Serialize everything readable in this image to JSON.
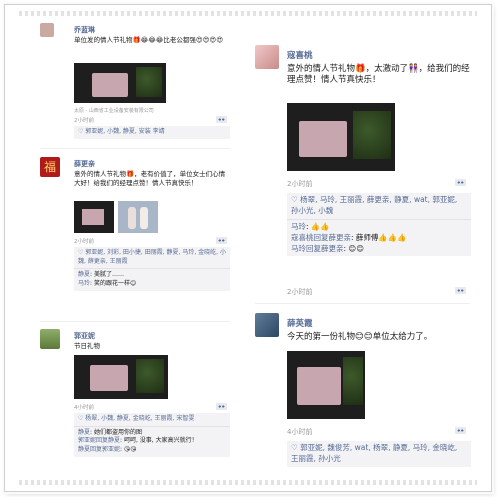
{
  "left_column": {
    "posts": [
      {
        "name": "乔蓝琳",
        "text": "单位发的情人节礼物🎁😂😂😂比老公都强😍😍😍😍",
        "location": "太原 · 山西省工业设备安装有限公司",
        "time": "2小时前",
        "likes": "♡ 郭亚妮, 小魏, 静夏, 安装 李靖"
      },
      {
        "name": "薛更亲",
        "text": "意外的情人节礼物🎁，老有价值了，单位女士们心情大好！给我们的经理点赞！情人节真快乐！",
        "time": "2小时前",
        "likes": "♡ 郭亚妮, 刘彩, 田小捷, 田丽霞, 静夏, 马玲, 金晓屹, 小魏, 薛更亲, 王丽霞",
        "comments": [
          {
            "who": "静夏",
            "text": "美腻了……"
          },
          {
            "who": "马玲",
            "text": "笑的跟花一样😊"
          }
        ]
      },
      {
        "name": "郭亚妮",
        "text": "节日礼物",
        "time": "4小时前",
        "likes": "♡ 杨翠, 小魏, 静夏, 金晓屹, 王丽霞, 宋智雯",
        "comments": [
          {
            "who": "静夏",
            "text": "她们都盗用你的图"
          },
          {
            "who": "郭亚妮回复静夏",
            "text": "呵呵, 没事, 大家高兴就行！"
          },
          {
            "who": "静夏回复郭亚妮",
            "text": "😘😘"
          }
        ]
      }
    ]
  },
  "right_column": {
    "posts": [
      {
        "name": "寇喜桃",
        "text": "意外的情人节礼物🎁，太激动了👭，给我们的经理点赞！情人节真快乐！",
        "time": "2小时前",
        "likes": "♡ 杨翠, 马玲, 王丽霞, 薛更亲, 静夏, wat, 郭亚妮, 孙小光, 小魏",
        "comments": [
          {
            "who": "马玲",
            "text": "👍👍"
          },
          {
            "who": "寇喜桃回复薛更亲",
            "text": "薛师傅👍👍👍"
          },
          {
            "who": "马玲回复薛更亲",
            "text": "😊😊"
          }
        ]
      },
      {
        "name": "薛英霞",
        "text": "今天的第一份礼物😊😊单位太给力了。",
        "time": "4小时前",
        "likes": "♡ 郭亚妮, 魏俊芳, wat, 杨翠, 静夏, 马玲, 金晓屹, 王丽霞, 孙小光"
      }
    ]
  },
  "icons": {
    "more": "more-dots-icon",
    "like": "heart-icon"
  },
  "colors": {
    "name": "#576b95",
    "time": "#9a9a9a",
    "likes_bg": "#f3f3f5"
  }
}
